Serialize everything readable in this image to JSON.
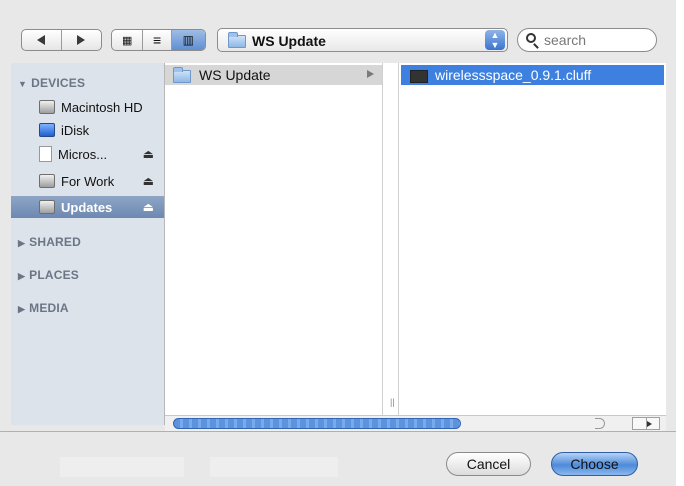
{
  "toolbar": {
    "location": "WS Update",
    "search_placeholder": "search"
  },
  "sidebar": {
    "sections": {
      "devices": "DEVICES",
      "shared": "SHARED",
      "places": "PLACES",
      "media": "MEDIA"
    },
    "items": [
      {
        "label": "Macintosh HD",
        "icon": "hard-disk-icon"
      },
      {
        "label": "iDisk",
        "icon": "idisk-icon"
      },
      {
        "label": "Micros...",
        "icon": "document-icon",
        "eject": "⏏"
      },
      {
        "label": "For Work",
        "icon": "hard-disk-icon",
        "eject": "⏏"
      },
      {
        "label": "Updates",
        "icon": "hard-disk-icon",
        "eject": "⏏",
        "selected": true
      }
    ]
  },
  "browser": {
    "column1": [
      {
        "label": "WS Update",
        "icon": "folder-icon"
      }
    ],
    "column2": [
      {
        "label": "wirelessspace_0.9.1.cluff",
        "icon": "file-icon"
      }
    ]
  },
  "buttons": {
    "cancel": "Cancel",
    "choose": "Choose"
  },
  "colors": {
    "selection": "#3d80df",
    "sidebar_bg": "#dde3ea",
    "sidebar_selection": "#7b93bb"
  }
}
